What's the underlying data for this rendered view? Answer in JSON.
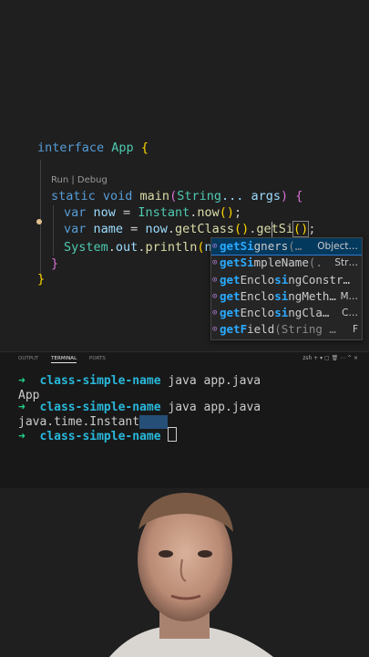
{
  "editor": {
    "codelens": "Run | Debug",
    "lines": {
      "interface_kw": "interface",
      "class_name": "App",
      "static_void": "static void",
      "main_name": "main",
      "string_type": "String",
      "args": "... args",
      "var1": "var",
      "now": "now",
      "instant": "Instant",
      "now_call": "now",
      "var2": "var",
      "name": "name",
      "now_ref": "now",
      "getclass": "getClass",
      "getsi": "getSi",
      "system": "System",
      "out": "out",
      "println": "println",
      "nam": "nam"
    }
  },
  "suggestions": [
    {
      "pre": "",
      "hl": "getSi",
      "mid": "gners",
      "sig": "(…",
      "type": "Object…"
    },
    {
      "pre": "",
      "hl": "getSi",
      "mid": "mpleName",
      "sig": "(.",
      "type": "Str…"
    },
    {
      "pre": "",
      "hl": "get",
      "mid": "Enclo",
      "hl2": "si",
      "post": "ngConstr…",
      "sig": "",
      "type": ""
    },
    {
      "pre": "",
      "hl": "get",
      "mid": "Enclo",
      "hl2": "si",
      "post": "ngMeth…",
      "sig": "",
      "type": "M…"
    },
    {
      "pre": "",
      "hl": "get",
      "mid": "Enclo",
      "hl2": "si",
      "post": "ngCla…",
      "sig": "",
      "type": "C…"
    },
    {
      "pre": "",
      "hl": "getF",
      "mid": "i",
      "post": "eld",
      "sig": "(String …",
      "type": "F"
    }
  ],
  "panel": {
    "tabs": [
      "OUTPUT",
      "TERMINAL",
      "PORTS"
    ],
    "tools": "zsh  +  ▾  ▢  🗑  ⋯  ^  ×",
    "lines": [
      {
        "arrow": "➜",
        "cwd": "class-simple-name",
        "cmd": " java app.java"
      },
      {
        "text": "App"
      },
      {
        "arrow": "➜",
        "cwd": "class-simple-name",
        "cmd": " java app.java"
      },
      {
        "text": "java.time.Instant"
      },
      {
        "arrow": "➜",
        "cwd": "class-simple-name",
        "cmd": " "
      }
    ]
  },
  "colors": {
    "accent": "#2aaaff",
    "keyword": "#569cd6",
    "prompt": "#23d18b",
    "cwd": "#29b8db"
  }
}
